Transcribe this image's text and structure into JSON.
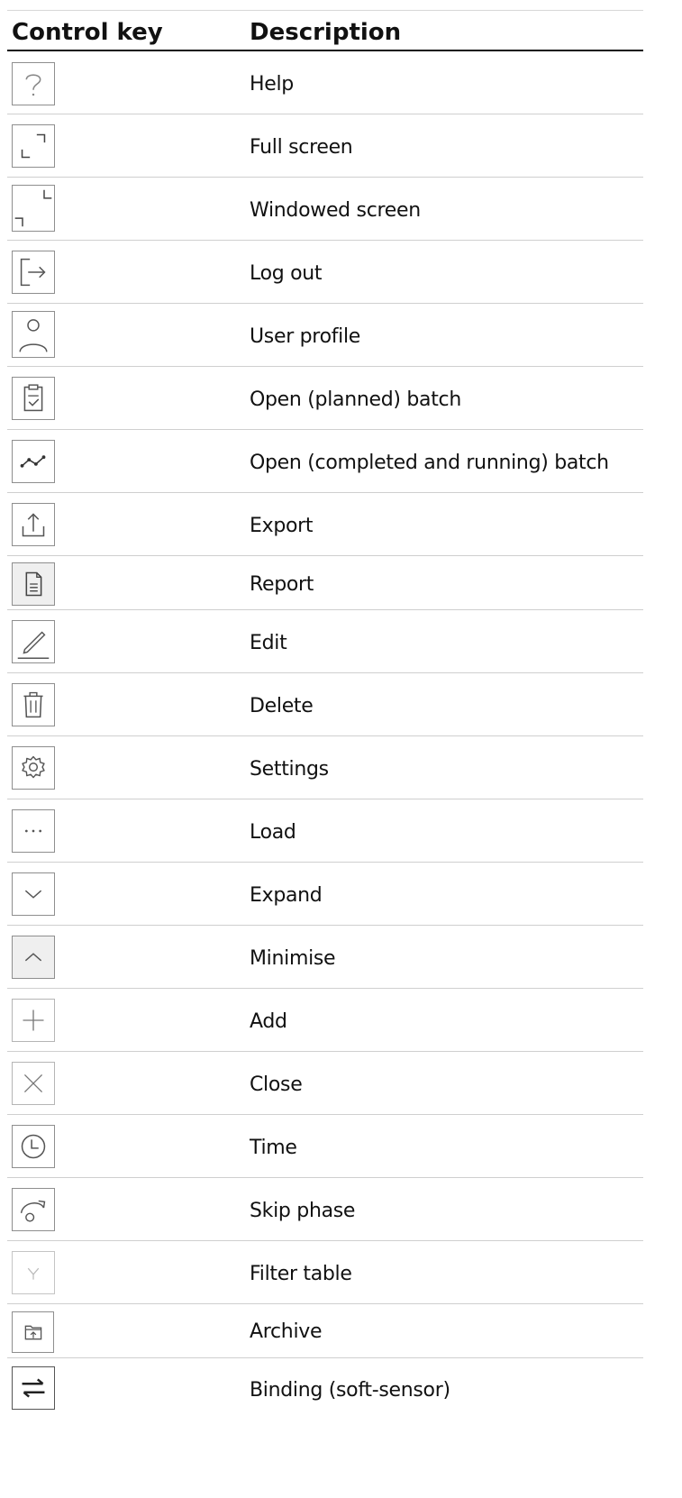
{
  "table": {
    "header": {
      "control_key": "Control key",
      "description": "Description"
    },
    "rows": [
      {
        "icon": "help-icon",
        "label": "Help"
      },
      {
        "icon": "full-screen-icon",
        "label": "Full screen"
      },
      {
        "icon": "windowed-screen-icon",
        "label": "Windowed screen"
      },
      {
        "icon": "log-out-icon",
        "label": "Log out"
      },
      {
        "icon": "user-profile-icon",
        "label": "User profile"
      },
      {
        "icon": "clipboard-icon",
        "label": "Open (planned) batch"
      },
      {
        "icon": "trend-line-icon",
        "label": "Open (completed and running) batch"
      },
      {
        "icon": "export-icon",
        "label": "Export"
      },
      {
        "icon": "report-icon",
        "label": "Report"
      },
      {
        "icon": "edit-icon",
        "label": "Edit"
      },
      {
        "icon": "delete-icon",
        "label": "Delete"
      },
      {
        "icon": "settings-icon",
        "label": "Settings"
      },
      {
        "icon": "load-icon",
        "label": "Load"
      },
      {
        "icon": "expand-icon",
        "label": "Expand"
      },
      {
        "icon": "minimise-icon",
        "label": "Minimise"
      },
      {
        "icon": "add-icon",
        "label": "Add"
      },
      {
        "icon": "close-icon",
        "label": "Close"
      },
      {
        "icon": "time-icon",
        "label": "Time"
      },
      {
        "icon": "skip-phase-icon",
        "label": "Skip phase"
      },
      {
        "icon": "filter-icon",
        "label": "Filter table"
      },
      {
        "icon": "archive-icon",
        "label": "Archive"
      },
      {
        "icon": "binding-icon",
        "label": "Binding (soft-sensor)"
      }
    ]
  }
}
